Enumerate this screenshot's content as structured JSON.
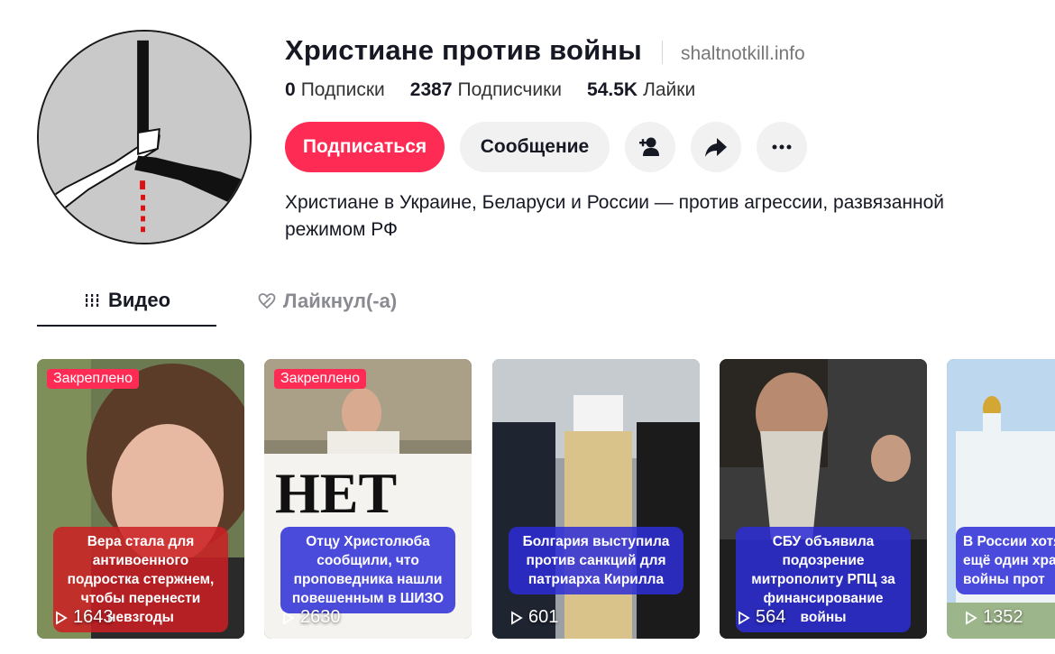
{
  "profile": {
    "name": "Христиане против войны",
    "website": "shaltnotkill.info",
    "bio": "Христиане в Украине, Беларуси и России — против агрессии, развязанной режимом РФ"
  },
  "stats": [
    {
      "value": "0",
      "label": "Подписки"
    },
    {
      "value": "2387",
      "label": "Подписчики"
    },
    {
      "value": "54.5K",
      "label": "Лайки"
    }
  ],
  "actions": {
    "follow": "Подписаться",
    "message": "Сообщение",
    "icons": [
      "add-friend-icon",
      "share-icon",
      "more-icon"
    ]
  },
  "tabs": [
    {
      "label": "Видео",
      "icon": "grid-icon",
      "active": true
    },
    {
      "label": "Лайкнул(-а)",
      "icon": "liked-heart-icon",
      "active": false
    }
  ],
  "videos": [
    {
      "pinned": "Закреплено",
      "caption": "Вера стала для антивоенного подростка стержнем, чтобы перенести невзгоды",
      "views": "1643",
      "caption_color": "red"
    },
    {
      "pinned": "Закреплено",
      "caption": "Отцу Христолюба сообщили, что проповедника нашли повешенным в ШИЗО",
      "views": "2630",
      "caption_color": "blue"
    },
    {
      "pinned": "",
      "caption": "Болгария выступила против санкций для патриарха Кирилла",
      "views": "601",
      "caption_color": "blue"
    },
    {
      "pinned": "",
      "caption": "СБУ объявила подозрение митрополиту РПЦ за финансирование войны",
      "views": "564",
      "caption_color": "blue"
    },
    {
      "pinned": "",
      "caption": "В России хотя ещё один храм войны прот",
      "views": "1352",
      "caption_color": "blue"
    }
  ],
  "colors": {
    "accent": "#fe2c55",
    "button_gray": "#f1f1f2",
    "caption_red": "#cd1e23",
    "caption_blue": "#2d2dd7"
  }
}
